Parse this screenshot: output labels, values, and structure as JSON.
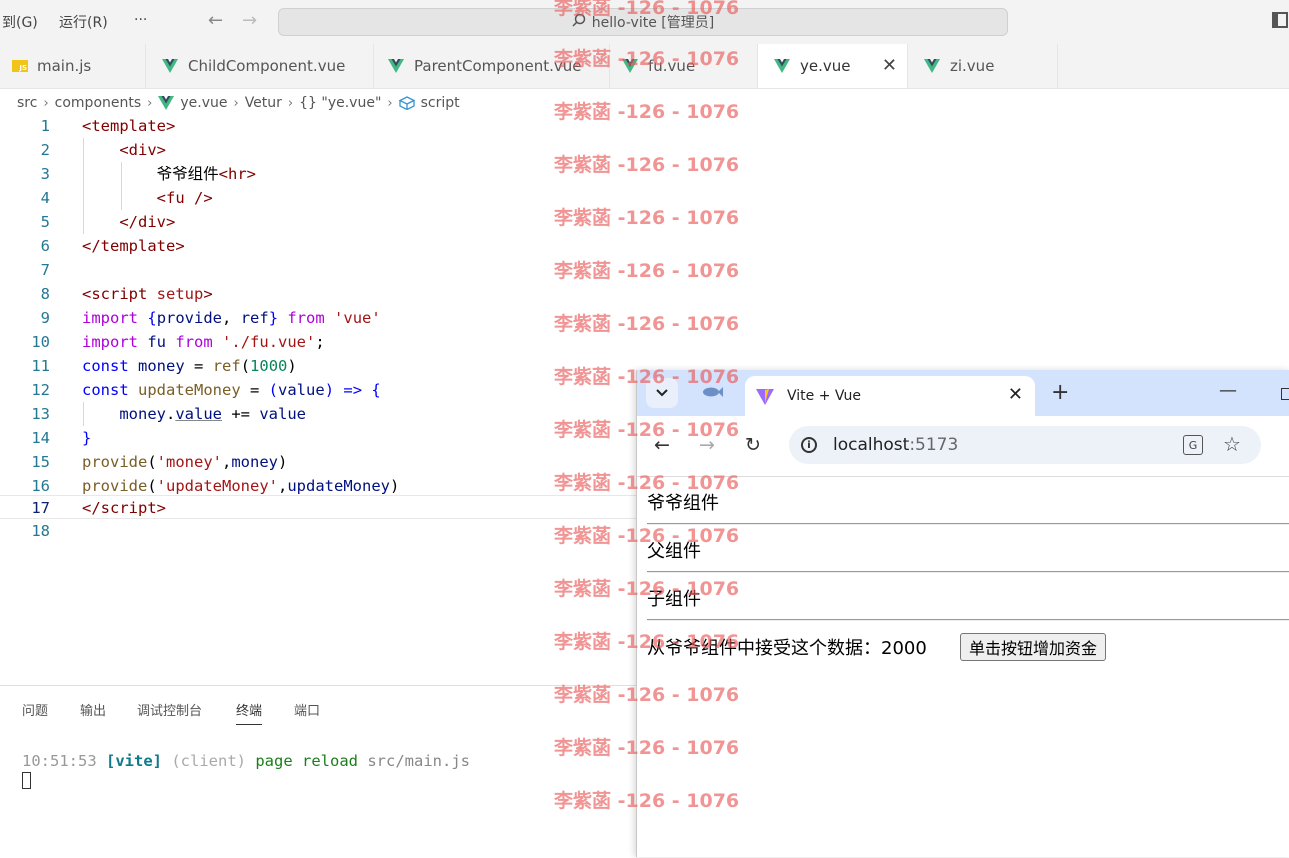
{
  "titlebar": {
    "menu_goto": "到(G)",
    "menu_run": "运行(R)",
    "menu_more": "···",
    "back_glyph": "←",
    "forward_glyph": "→",
    "search_icon": "search-icon",
    "search_text": "hello-vite [管理员]"
  },
  "tabs": [
    {
      "label": "main.js",
      "icon": "js-icon"
    },
    {
      "label": "ChildComponent.vue",
      "icon": "vue-icon"
    },
    {
      "label": "ParentComponent.vue",
      "icon": "vue-icon"
    },
    {
      "label": "fu.vue",
      "icon": "vue-icon"
    },
    {
      "label": "ye.vue",
      "icon": "vue-icon",
      "active": true
    },
    {
      "label": "zi.vue",
      "icon": "vue-icon"
    }
  ],
  "tab_close_glyph": "✕",
  "breadcrumb": {
    "items": [
      "src",
      "components",
      "ye.vue",
      "Vetur",
      "{} \"ye.vue\"",
      "script"
    ],
    "separator": "›"
  },
  "editor": {
    "line_numbers": [
      "1",
      "2",
      "3",
      "4",
      "5",
      "6",
      "7",
      "8",
      "9",
      "10",
      "11",
      "12",
      "13",
      "14",
      "15",
      "16",
      "17",
      "18"
    ],
    "current_line": "17"
  },
  "panel": {
    "tabs": [
      "问题",
      "输出",
      "调试控制台",
      "终端",
      "端口"
    ],
    "active_tab": "终端",
    "terminal": {
      "time": "10:51:53",
      "tag": "[vite]",
      "client": "(client)",
      "message": "page reload",
      "path": "src/main.js"
    }
  },
  "watermark": {
    "text": "李紫菡 -126 - 1076",
    "color": "#e95a5a"
  },
  "browser": {
    "tab_title": "Vite + Vue",
    "tab_list_glyph": "⌄",
    "new_tab_glyph": "+",
    "minimize_glyph": "—",
    "close_glyph": "✕",
    "back_glyph": "←",
    "forward_glyph": "→",
    "reload_glyph": "↻",
    "url_host": "localhost",
    "url_port": ":5173",
    "info_glyph": "i",
    "translate_glyph": "G",
    "star_glyph": "☆",
    "content": {
      "grandparent": "爷爷组件",
      "parent": "父组件",
      "child": "子组件",
      "received_text": "从爷爷组件中接受这个数据：2000",
      "button_label": "单击按钮增加资金"
    }
  }
}
